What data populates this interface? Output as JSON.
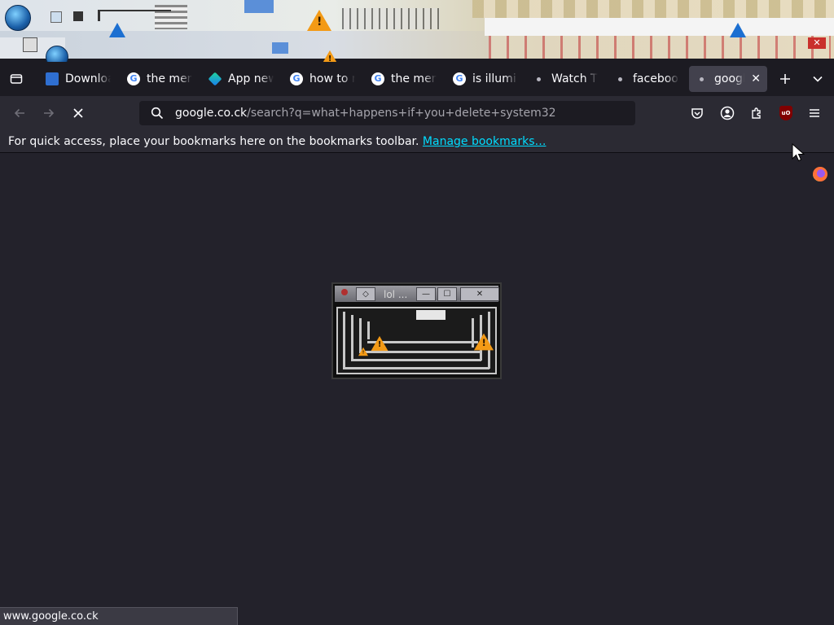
{
  "tabs": [
    {
      "label": "Downloa",
      "favicon": "download-page-icon"
    },
    {
      "label": "the men",
      "favicon": "google-g-icon"
    },
    {
      "label": "App new",
      "favicon": "app-icon"
    },
    {
      "label": "how to ra",
      "favicon": "google-g-icon"
    },
    {
      "label": "the men",
      "favicon": "google-g-icon"
    },
    {
      "label": "is illumi",
      "favicon": "google-g-icon"
    },
    {
      "label": "Watch T",
      "favicon": "loading-dot-icon"
    },
    {
      "label": "faceboo",
      "favicon": "loading-dot-icon"
    },
    {
      "label": "googl",
      "favicon": "loading-dot-icon",
      "active": true
    }
  ],
  "urlbar": {
    "host": "google.co.ck",
    "path": "/search?q=what+happens+if+you+delete+system32"
  },
  "bookmarks": {
    "message": "For quick access, place your bookmarks here on the bookmarks toolbar.",
    "link": "Manage bookmarks…"
  },
  "popup": {
    "title": "lol ..."
  },
  "status": {
    "url": "www.google.co.ck"
  },
  "colors": {
    "accent_link": "#00ddff",
    "tabbar_bg": "#1c1b22",
    "toolbar_bg": "#2b2a33",
    "content_bg": "#23222b",
    "warning_orange": "#f39a16"
  }
}
